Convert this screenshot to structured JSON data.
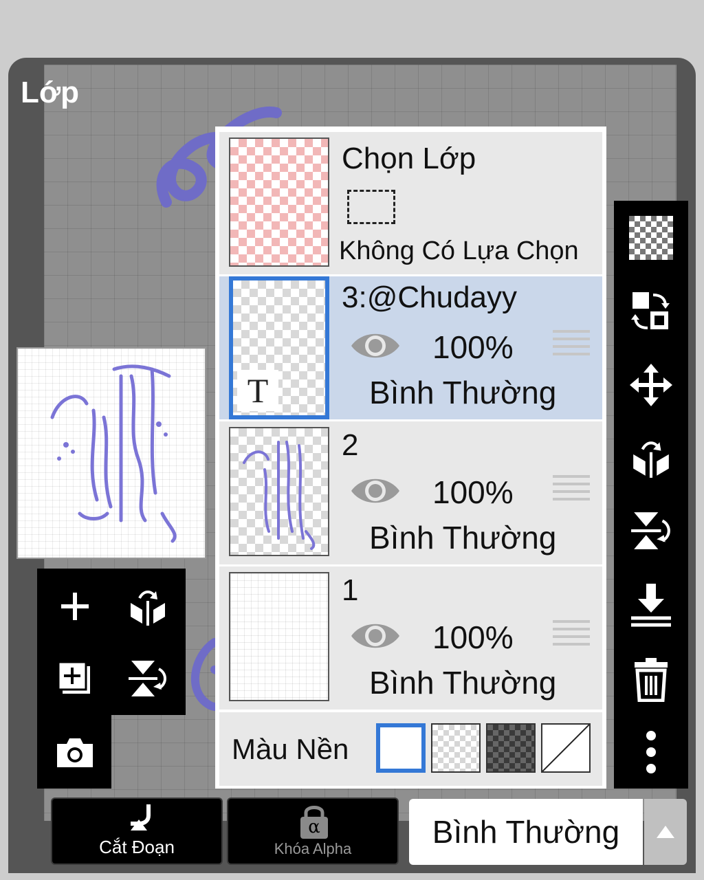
{
  "panel": {
    "title": "Lớp"
  },
  "selection_layer": {
    "title": "Chọn Lớp",
    "status": "Không Có Lựa Chọn"
  },
  "layers": [
    {
      "name": "3:@Chudayy",
      "opacity": "100%",
      "blend": "Bình Thường",
      "selected": true,
      "type": "text",
      "type_glyph": "T"
    },
    {
      "name": "2",
      "opacity": "100%",
      "blend": "Bình Thường",
      "selected": false,
      "type": "raster"
    },
    {
      "name": "1",
      "opacity": "100%",
      "blend": "Bình Thường",
      "selected": false,
      "type": "raster"
    }
  ],
  "background": {
    "label": "Màu Nền",
    "options": [
      "white",
      "light-checker",
      "dark-checker",
      "none"
    ],
    "selected": "white"
  },
  "bottom_bar": {
    "clip_label": "Cắt Đoạn",
    "alpha_lock_label": "Khóa Alpha",
    "alpha_glyph": "α",
    "blend_mode": "Bình Thường"
  },
  "left_tools": [
    "add-layer-icon",
    "flip-horizontal-icon",
    "duplicate-layer-icon",
    "flip-vertical-icon",
    "camera-icon"
  ],
  "right_tools": [
    "transparency-icon",
    "swap-layer-icon",
    "move-icon",
    "flip-horizontal-icon",
    "flip-vertical-icon",
    "merge-down-icon",
    "trash-icon",
    "more-icon"
  ],
  "colors": {
    "accent": "#3478d6",
    "selected_row": "#cad7ea",
    "row": "#e8e8e8",
    "toolbar": "#000000",
    "artwork": "#6f6cc7"
  }
}
